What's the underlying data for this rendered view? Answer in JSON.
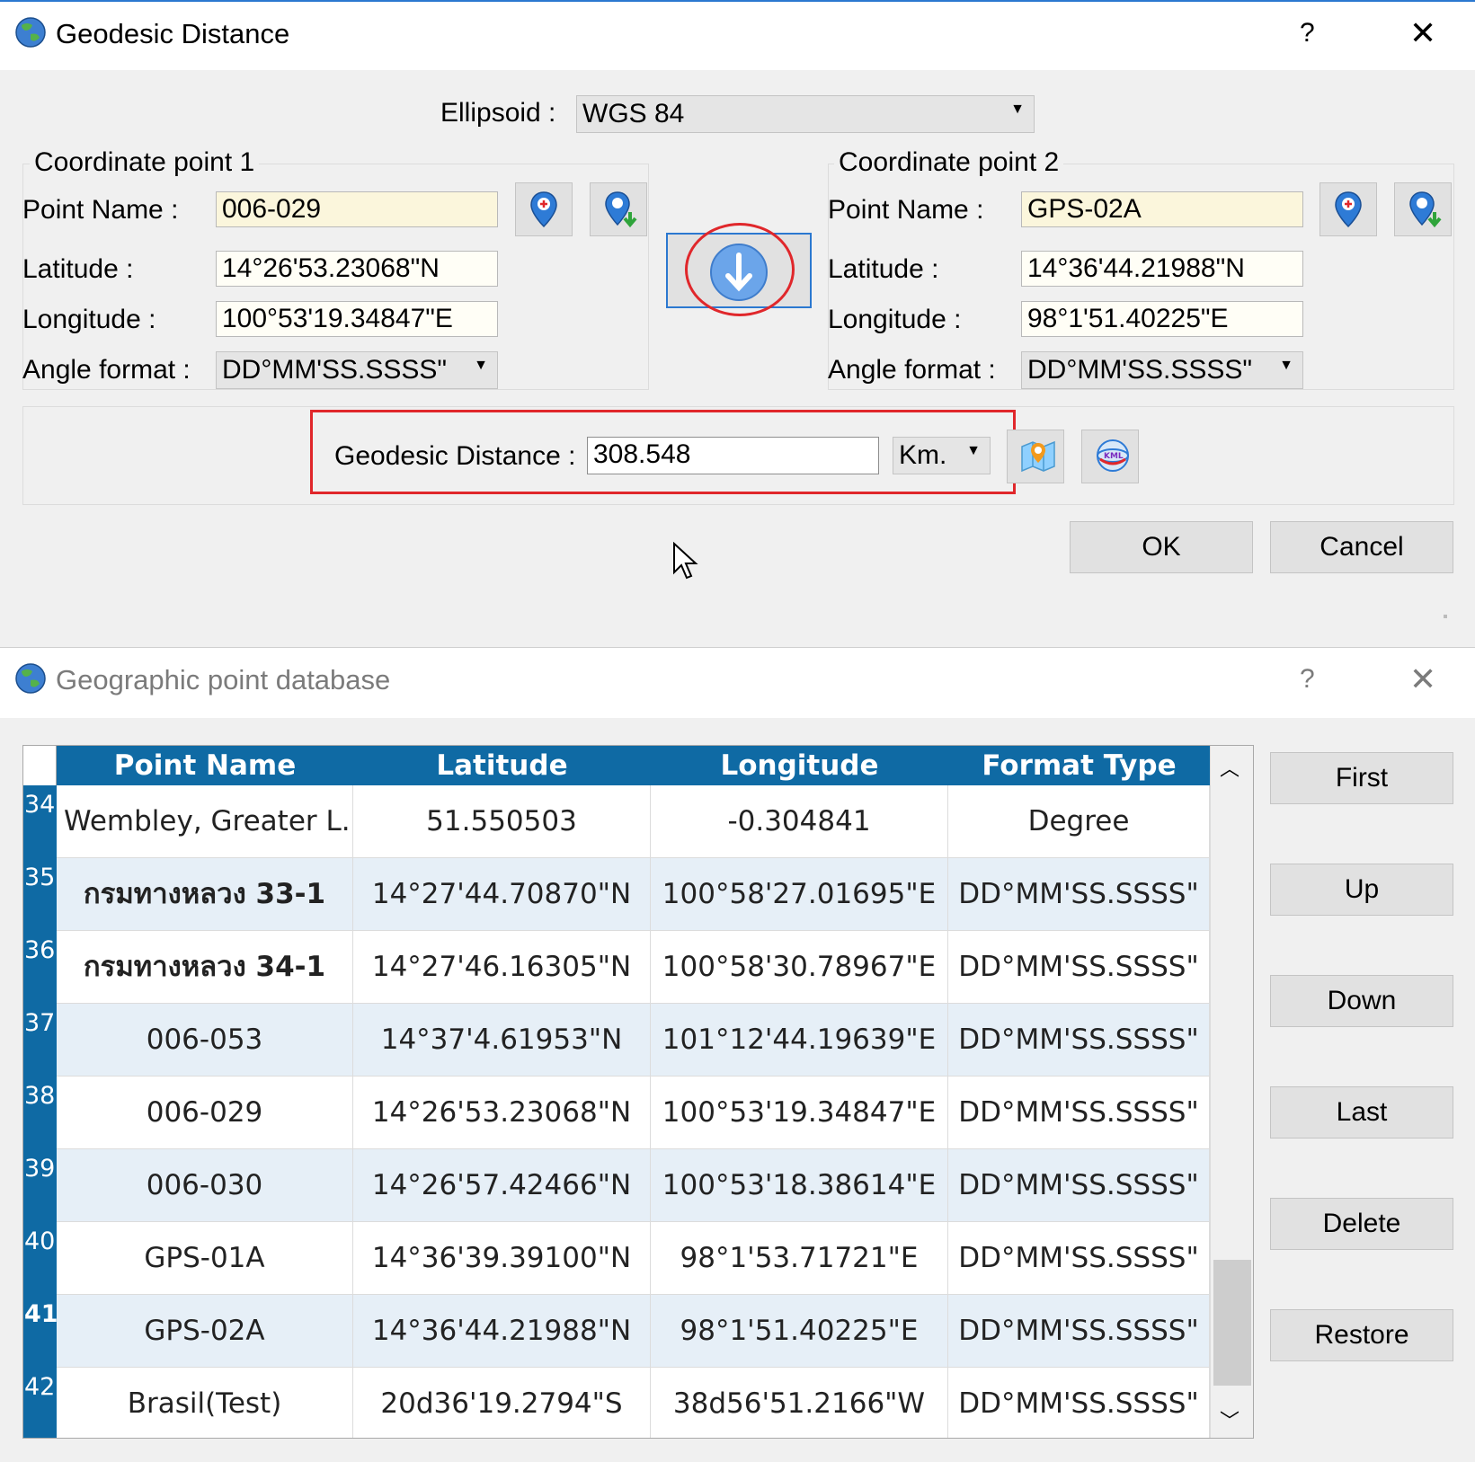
{
  "dialog1": {
    "title": "Geodesic Distance",
    "help": "?",
    "close": "✕",
    "ellipsoid_label": "Ellipsoid :",
    "ellipsoid_value": "WGS 84",
    "point1": {
      "group_title": "Coordinate point 1",
      "name_label": "Point Name :",
      "name_value": "006-029",
      "lat_label": "Latitude :",
      "lat_value": "14°26'53.23068\"N",
      "lon_label": "Longitude :",
      "lon_value": "100°53'19.34847\"E",
      "angle_label": "Angle format :",
      "angle_value": "DD°MM'SS.SSSS\""
    },
    "point2": {
      "group_title": "Coordinate point 2",
      "name_label": "Point Name :",
      "name_value": "GPS-02A",
      "lat_label": "Latitude :",
      "lat_value": "14°36'44.21988\"N",
      "lon_label": "Longitude :",
      "lon_value": "98°1'51.40225\"E",
      "angle_label": "Angle format :",
      "angle_value": "DD°MM'SS.SSSS\""
    },
    "distance_label": "Geodesic Distance :",
    "distance_value": "308.548",
    "unit_value": "Km.",
    "ok_label": "OK",
    "cancel_label": "Cancel",
    "colors": {
      "highlight": "#e0272b",
      "accent": "#2b78d0"
    }
  },
  "dialog2": {
    "title": "Geographic point database",
    "help": "?",
    "close": "✕",
    "columns": [
      "Point Name",
      "Latitude",
      "Longitude",
      "Format Type"
    ],
    "rows": [
      {
        "num": "34",
        "name": "Wembley, Greater L...",
        "lat": "51.550503",
        "lon": "-0.304841",
        "fmt": "Degree"
      },
      {
        "num": "35",
        "name": "กรมทางหลวง 33-1",
        "lat": "14°27'44.70870\"N",
        "lon": "100°58'27.01695\"E",
        "fmt": "DD°MM'SS.SSSS\""
      },
      {
        "num": "36",
        "name": "กรมทางหลวง 34-1",
        "lat": "14°27'46.16305\"N",
        "lon": "100°58'30.78967\"E",
        "fmt": "DD°MM'SS.SSSS\""
      },
      {
        "num": "37",
        "name": "006-053",
        "lat": "14°37'4.61953\"N",
        "lon": "101°12'44.19639\"E",
        "fmt": "DD°MM'SS.SSSS\""
      },
      {
        "num": "38",
        "name": "006-029",
        "lat": "14°26'53.23068\"N",
        "lon": "100°53'19.34847\"E",
        "fmt": "DD°MM'SS.SSSS\""
      },
      {
        "num": "39",
        "name": "006-030",
        "lat": "14°26'57.42466\"N",
        "lon": "100°53'18.38614\"E",
        "fmt": "DD°MM'SS.SSSS\""
      },
      {
        "num": "40",
        "name": "GPS-01A",
        "lat": "14°36'39.39100\"N",
        "lon": "98°1'53.71721\"E",
        "fmt": "DD°MM'SS.SSSS\""
      },
      {
        "num": "41",
        "name": "GPS-02A",
        "lat": "14°36'44.21988\"N",
        "lon": "98°1'51.40225\"E",
        "fmt": "DD°MM'SS.SSSS\""
      },
      {
        "num": "42",
        "name": "Brasil(Test)",
        "lat": "20d36'19.2794\"S",
        "lon": "38d56'51.2166\"W",
        "fmt": "DD°MM'SS.SSSS\""
      }
    ],
    "nav_buttons": [
      "First",
      "Up",
      "Down",
      "Last",
      "Delete",
      "Restore"
    ]
  },
  "icons": [
    "globe-icon",
    "map-pin-add-icon",
    "map-pin-download-icon",
    "swap-down-icon",
    "map-distance-icon",
    "kml-globe-icon",
    "mouse-cursor-icon"
  ]
}
